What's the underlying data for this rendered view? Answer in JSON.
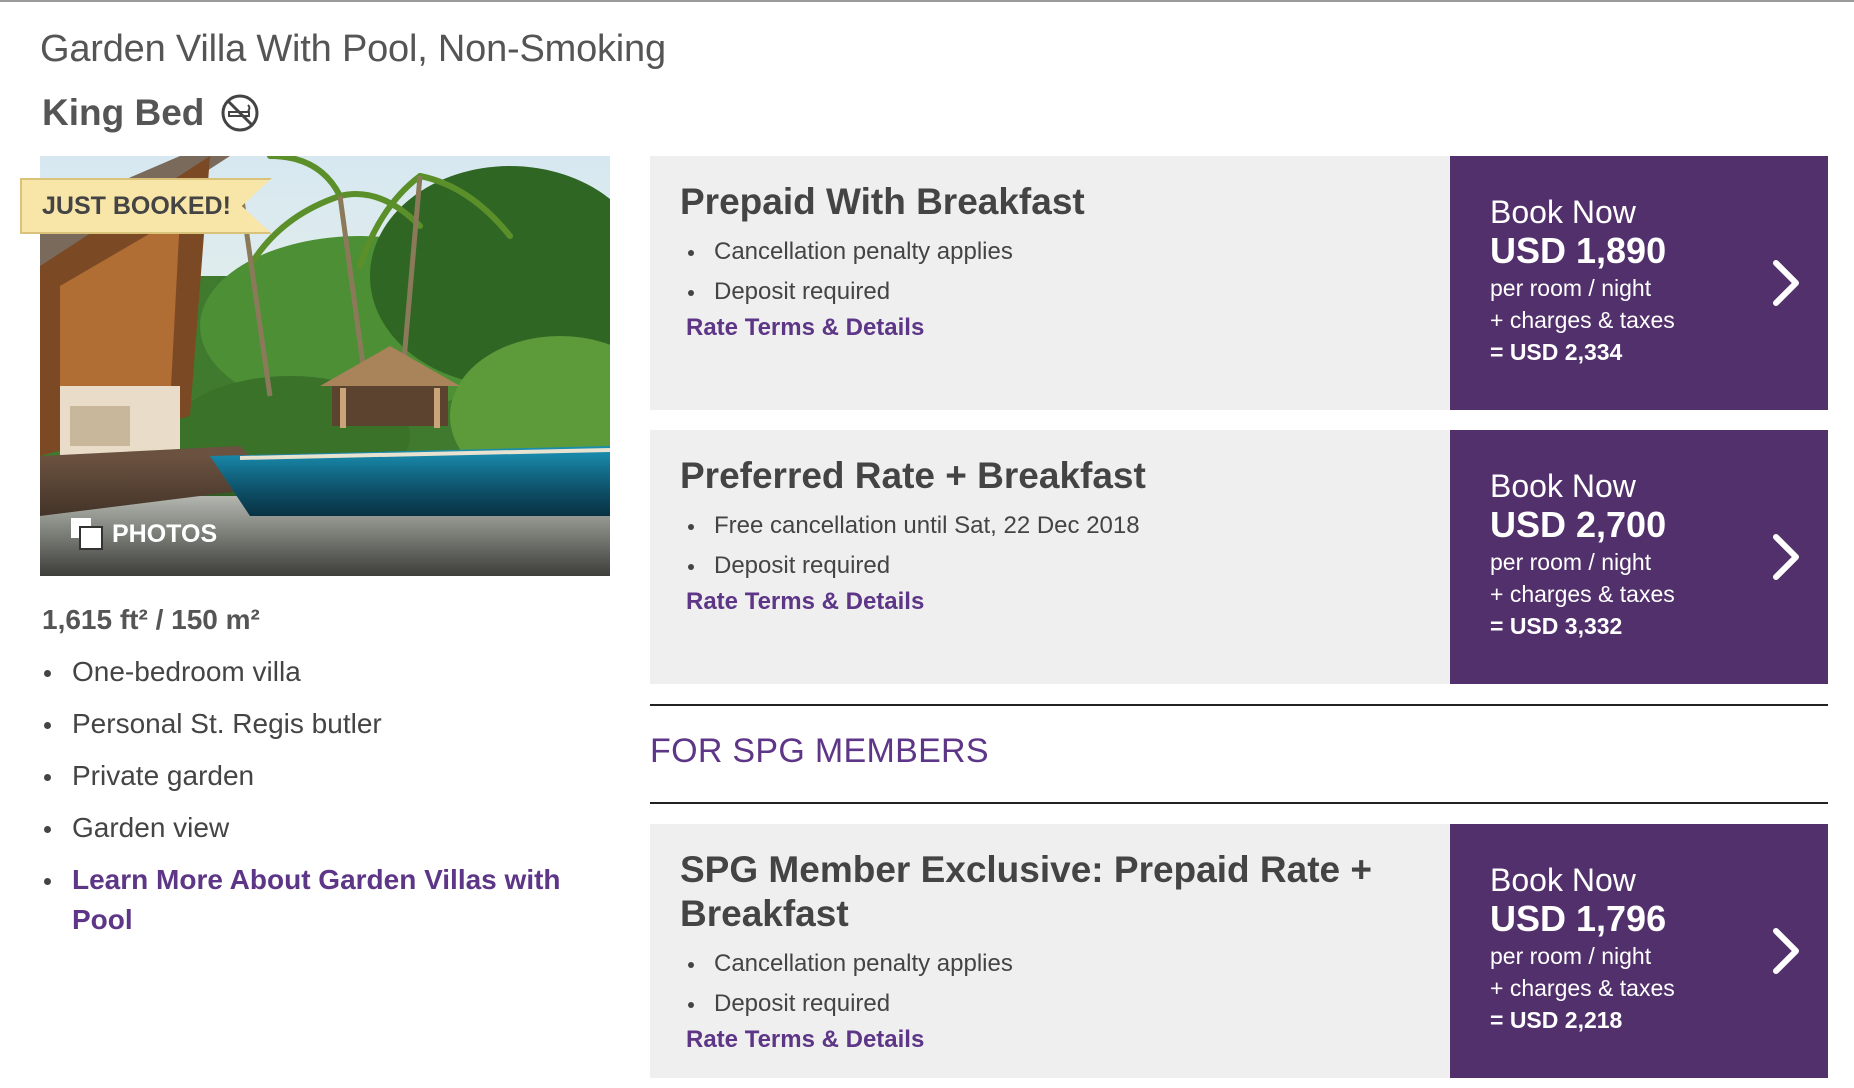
{
  "room": {
    "title": "Garden Villa With Pool, Non-Smoking",
    "bed_type": "King Bed",
    "badge": "JUST BOOKED!",
    "photos_label": "PHOTOS",
    "size": "1,615 ft² / 150 m²",
    "features": [
      "One-bedroom villa",
      "Personal St. Regis butler",
      "Private garden",
      "Garden view"
    ],
    "learn_more": "Learn More About Garden Villas with Pool"
  },
  "rates": [
    {
      "name": "Prepaid With Breakfast",
      "bullets": [
        "Cancellation penalty applies",
        "Deposit required"
      ],
      "terms_label": "Rate Terms & Details",
      "book_label": "Book Now",
      "price": "USD 1,890",
      "unit": "per room / night",
      "charges": "+ charges & taxes",
      "total": "= USD 2,334"
    },
    {
      "name": "Preferred Rate + Breakfast",
      "bullets": [
        "Free cancellation until Sat, 22 Dec 2018",
        "Deposit required"
      ],
      "terms_label": "Rate Terms & Details",
      "book_label": "Book Now",
      "price": "USD 2,700",
      "unit": "per room / night",
      "charges": "+ charges & taxes",
      "total": "= USD 3,332"
    }
  ],
  "members_section": {
    "title": "FOR SPG MEMBERS",
    "rates": [
      {
        "name": "SPG Member Exclusive: Prepaid Rate + Breakfast",
        "bullets": [
          "Cancellation penalty applies",
          "Deposit required"
        ],
        "terms_label": "Rate Terms & Details",
        "book_label": "Book Now",
        "price": "USD 1,796",
        "unit": "per room / night",
        "charges": "+ charges & taxes",
        "total": "= USD 2,218"
      }
    ]
  },
  "colors": {
    "accent_purple": "#52306b",
    "link_purple": "#5d3687",
    "rate_background": "#efefef",
    "badge_yellow": "#f8e5a8"
  },
  "icons": [
    "no-smoking-icon",
    "photos-icon",
    "chevron-right-icon"
  ]
}
